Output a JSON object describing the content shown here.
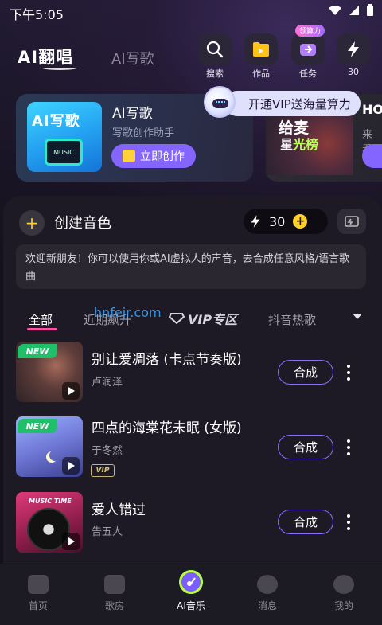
{
  "status_bar": {
    "time": "下午5:05"
  },
  "header": {
    "logo": "AI翻唱",
    "tab_write": "AI写歌",
    "buttons": [
      {
        "label": "搜索",
        "icon": "search-icon"
      },
      {
        "label": "作品",
        "icon": "folder-icon"
      },
      {
        "label": "任务",
        "icon": "task-icon",
        "badge": "领算力"
      },
      {
        "label": "30",
        "icon": "lightning-icon"
      }
    ]
  },
  "vip_tooltip": {
    "text": "开通VIP送海量算力"
  },
  "banner": {
    "image_title": "AI写歌",
    "image_caption": "MUSIC",
    "title": "AI写歌",
    "subtitle": "写歌创作助手",
    "button_label": "立即创作"
  },
  "banner2": {
    "line1": "给麦",
    "line2_a": "星",
    "line2_b": "光榜",
    "side_title": "HO",
    "side_sub": "来看"
  },
  "voice_panel": {
    "title": "创建音色",
    "credits": "30",
    "notice": "欢迎新朋友！你可以使用你或AI虚拟人的声音，去合成任意风格/语言歌曲"
  },
  "categories": {
    "all": "全部",
    "recent": "近期飙升",
    "vip": "VIP专区",
    "douyin": "抖音热歌"
  },
  "watermark": "hnfejr.com",
  "songs": [
    {
      "title": "别让爱凋落 (卡点节奏版)",
      "artist": "卢润泽",
      "tag": "NEW",
      "action": "合成"
    },
    {
      "title": "四点的海棠花未眠 (女版)",
      "artist": "于冬然",
      "tag": "NEW",
      "vip": "VIP",
      "action": "合成"
    },
    {
      "title": "爱人错过",
      "artist": "告五人",
      "cover_text": "MUSIC TIME",
      "action": "合成"
    }
  ],
  "nav": [
    {
      "label": "首页",
      "icon": "home-icon"
    },
    {
      "label": "歌房",
      "icon": "tv-icon"
    },
    {
      "label": "AI音乐",
      "icon": "ai-music-icon",
      "active": true
    },
    {
      "label": "消息",
      "icon": "message-icon"
    },
    {
      "label": "我的",
      "icon": "profile-icon"
    }
  ],
  "colors": {
    "accent": "#8565ff",
    "new_tag": "#20c06a",
    "tab_underline": "#ff4fa3",
    "credit_yellow": "#ffd02a"
  }
}
